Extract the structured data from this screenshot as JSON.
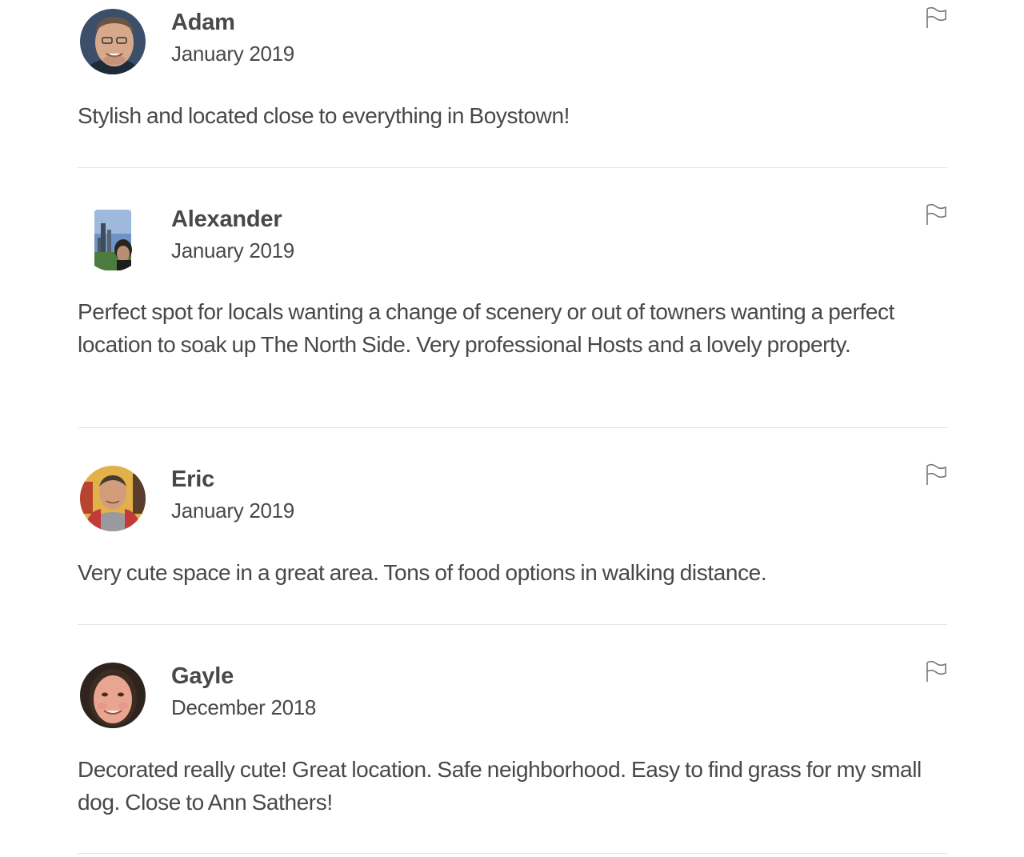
{
  "reviews": [
    {
      "name": "Adam",
      "date": "January 2019",
      "text": "Stylish and located close to everything in Boystown!",
      "avatar": "avatar-photo-adam",
      "flag_icon": "flag-icon"
    },
    {
      "name": "Alexander",
      "date": "January 2019",
      "text": "Perfect spot for locals wanting a change of scenery or out of towners wanting a perfect location to soak up The North Side. Very professional Hosts and a lovely property.",
      "avatar": "avatar-photo-alexander",
      "flag_icon": "flag-icon"
    },
    {
      "name": "Eric",
      "date": "January 2019",
      "text": "Very cute space in a great area. Tons of food options in walking distance.",
      "avatar": "avatar-photo-eric",
      "flag_icon": "flag-icon"
    },
    {
      "name": "Gayle",
      "date": "December 2018",
      "text": "Decorated really cute! Great location. Safe neighborhood. Easy to find grass for my small dog. Close to Ann Sathers!",
      "avatar": "avatar-photo-gayle",
      "flag_icon": "flag-icon"
    }
  ],
  "colors": {
    "text": "#484848",
    "divider": "#e4e4e4",
    "flag_stroke": "#767676"
  }
}
